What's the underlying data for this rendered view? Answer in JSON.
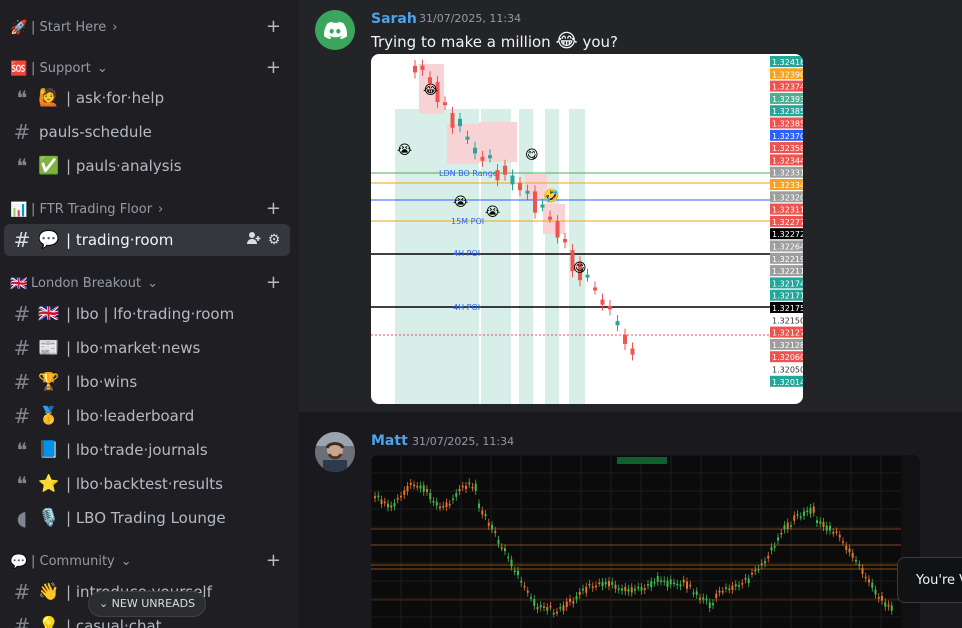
{
  "sidebar": {
    "categories": [
      {
        "emoji": "🚀",
        "label": "| Start Here",
        "chevron": "›",
        "add": "+"
      },
      {
        "emoji": "🆘",
        "label": "| Support",
        "chevron": "⌄",
        "add": "+"
      },
      {
        "emoji": "📊",
        "label": "| FTR Trading Floor",
        "chevron": "›",
        "add": "+"
      },
      {
        "emoji": "🇬🇧",
        "label": "London Breakout",
        "chevron": "⌄",
        "add": "+"
      },
      {
        "emoji": "💬",
        "label": "| Community",
        "chevron": "⌄",
        "add": "+"
      }
    ],
    "channels": [
      {
        "icon": "forum-icon",
        "emoji": "🙋",
        "name": "| ask·for·help"
      },
      {
        "icon": "hashtag-icon",
        "emoji": "",
        "name": "pauls-schedule"
      },
      {
        "icon": "forum-icon",
        "emoji": "✅",
        "name": "| pauls·analysis"
      },
      {
        "icon": "hashtag-icon",
        "emoji": "💬",
        "name": "| trading·room"
      },
      {
        "icon": "hashtag-icon",
        "emoji": "🇬🇧",
        "name": "| lbo | lfo·trading·room"
      },
      {
        "icon": "hashtag-icon",
        "emoji": "📰",
        "name": "| lbo·market·news"
      },
      {
        "icon": "hashtag-icon",
        "emoji": "🏆",
        "name": "| lbo·wins"
      },
      {
        "icon": "hashtag-icon",
        "emoji": "🥇",
        "name": "| lbo·leaderboard"
      },
      {
        "icon": "forum-icon",
        "emoji": "📘",
        "name": "| lbo·trade·journals"
      },
      {
        "icon": "forum-icon",
        "emoji": "⭐",
        "name": "| lbo·backtest·results"
      },
      {
        "icon": "stage-icon",
        "emoji": "🎙️",
        "name": "| LBO Trading Lounge"
      },
      {
        "icon": "hashtag-icon",
        "emoji": "👋",
        "name": "| introduce·yourself"
      },
      {
        "icon": "hashtag-icon",
        "emoji": "💡",
        "name": "| casual·chat"
      }
    ],
    "new_unreads": "NEW UNREADS"
  },
  "messages": [
    {
      "author": "Sarah",
      "timestamp": "31/07/2025, 11:34",
      "text": "Trying to make a million",
      "emoji": "😂",
      "text_after": "you?",
      "chart_labels": {
        "ldn_bo_range": "LDN BO Range",
        "poi_15m": "15M POI",
        "poi_4h_a": "4H POI",
        "poi_4h_b": "4H POI"
      },
      "price_ladder": [
        {
          "price": "1.32418",
          "color": "#26a69a"
        },
        {
          "price": "1.32390",
          "color": "#f6a21e"
        },
        {
          "price": "1.32374",
          "color": "#ef5350"
        },
        {
          "price": "1.32393",
          "color": "#4caf8f"
        },
        {
          "price": "1.32385",
          "color": "#26a69a"
        },
        {
          "price": "1.32385",
          "color": "#ef5350"
        },
        {
          "price": "1.32370",
          "color": "#2962ff"
        },
        {
          "price": "1.32358",
          "color": "#ef5350"
        },
        {
          "price": "1.32344",
          "color": "#ef5350"
        },
        {
          "price": "1.32331",
          "color": "#9e9e9e"
        },
        {
          "price": "1.32334",
          "color": "#f6a21e"
        },
        {
          "price": "1.32320",
          "color": "#9e9e9e"
        },
        {
          "price": "1.32311",
          "color": "#ef5350"
        },
        {
          "price": "1.32277",
          "color": "#ef5350"
        },
        {
          "price": "1.32272",
          "color": "#000000"
        },
        {
          "price": "1.32264",
          "color": "#9e9e9e"
        },
        {
          "price": "1.32219",
          "color": "#9e9e9e"
        },
        {
          "price": "1.32211",
          "color": "#9e9e9e"
        },
        {
          "price": "1.32174",
          "color": "#26a69a"
        },
        {
          "price": "1.32171",
          "color": "#26a69a"
        },
        {
          "price": "1.32175",
          "color": "#000000"
        },
        {
          "price": "1.32150",
          "color": "#ffffff"
        },
        {
          "price": "1.32127",
          "color": "#ef5350"
        },
        {
          "price": "1.32128",
          "color": "#9e9e9e"
        },
        {
          "price": "1.32060",
          "color": "#ef5350"
        },
        {
          "price": "1.32050",
          "color": "#ffffff"
        },
        {
          "price": "1.32014",
          "color": "#26a69a"
        }
      ]
    },
    {
      "author": "Matt",
      "timestamp": "31/07/2025, 11:34"
    }
  ],
  "toast": "You're V",
  "colors": {
    "accent": "#4ea3e8",
    "discord_green": "#3ba55d",
    "active_bg": "#35373c"
  }
}
